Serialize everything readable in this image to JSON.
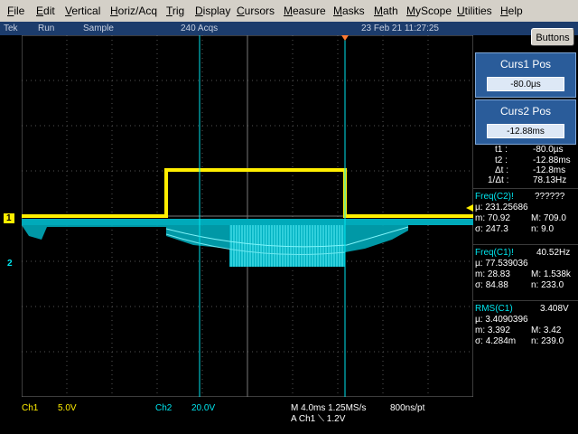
{
  "menu": [
    "File",
    "Edit",
    "Vertical",
    "Horiz/Acq",
    "Trig",
    "Display",
    "Cursors",
    "Measure",
    "Masks",
    "Math",
    "MyScope",
    "Utilities",
    "Help"
  ],
  "status": {
    "brand": "Tek",
    "mode": "Run",
    "acq_mode": "Sample",
    "acqs": "240 Acqs",
    "datetime": "23 Feb 21 11:27:25"
  },
  "buttons_label": "Buttons",
  "colors": {
    "ch1": "#ffee00",
    "ch2": "#00e5ee",
    "panel_blue": "#2a5c9a",
    "status_bar": "#1c3c6c"
  },
  "markers": {
    "ch1_ref": "1",
    "ch2_ref": "2"
  },
  "cursors": {
    "c1": {
      "label": "Curs1 Pos",
      "value": "-80.0µs"
    },
    "c2": {
      "label": "Curs2 Pos",
      "value": "-12.88ms"
    },
    "readout": {
      "t1_label": "t1 :",
      "t1_value": "-80.0µs",
      "t2_label": "t2 :",
      "t2_value": "-12.88ms",
      "dt_label": "Δt :",
      "dt_value": "-12.8ms",
      "inv_label": "1/Δt :",
      "inv_value": "78.13Hz"
    }
  },
  "measurements": [
    {
      "name": "Freq(C2)!",
      "value": "??????",
      "mu": "µ: 231.25686",
      "m": "m: 70.92",
      "M": "M: 709.0",
      "sigma": "σ: 247.3",
      "n": "n: 9.0"
    },
    {
      "name": "Freq(C1)!",
      "value": "40.52Hz",
      "mu": "µ: 77.539036",
      "m": "m: 28.83",
      "M": "M: 1.538k",
      "sigma": "σ: 84.88",
      "n": "n: 233.0"
    },
    {
      "name": "RMS(C1)",
      "value": "3.408V",
      "mu": "µ: 3.4090396",
      "m": "m: 3.392",
      "M": "M: 3.42",
      "sigma": "σ: 4.284m",
      "n": "n: 239.0"
    }
  ],
  "bottom": {
    "ch1_label": "Ch1",
    "ch1_scale": "5.0V",
    "ch2_label": "Ch2",
    "ch2_scale": "20.0V",
    "timebase": "M 4.0ms 1.25MS/s",
    "record": "800ns/pt",
    "trigger": "A  Ch1  ⟍  1.2V"
  }
}
